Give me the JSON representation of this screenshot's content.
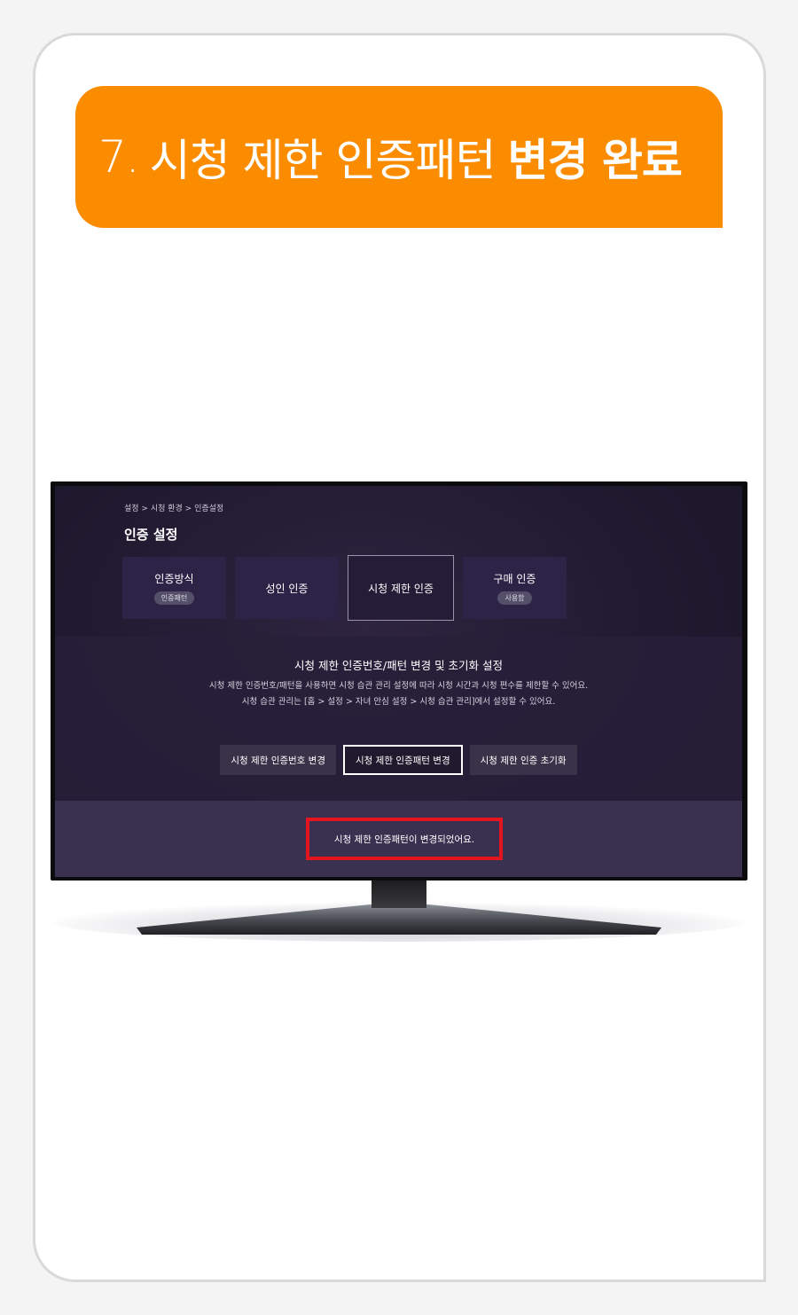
{
  "step_banner": {
    "number": "7.",
    "text_light": "시청 제한 인증패턴",
    "text_bold": "변경 완료"
  },
  "tv_screen": {
    "breadcrumb": "설정 > 시청 환경 > 인증설정",
    "page_title": "인증 설정",
    "menu": [
      {
        "label": "인증방식",
        "badge": "인증패턴",
        "selected": false
      },
      {
        "label": "성인 인증",
        "badge": "",
        "selected": false
      },
      {
        "label": "시청 제한 인증",
        "badge": "",
        "selected": true
      },
      {
        "label": "구매 인증",
        "badge": "사용함",
        "selected": false
      }
    ],
    "info": {
      "title": "시청 제한 인증번호/패턴 변경 및 초기화 설정",
      "desc_line1": "시청 제한 인증번호/패턴을 사용하면 시청 습관 관리 설정에 따라 시청 시간과 시청 편수를 제한할 수 있어요.",
      "desc_line2": "시청 습관 관리는 [홈 > 설정 > 자녀 안심 설정 > 시청 습관 관리]에서 설정할 수 있어요."
    },
    "buttons": [
      {
        "label": "시청 제한 인증번호 변경",
        "focused": false
      },
      {
        "label": "시청 제한 인증패턴 변경",
        "focused": true
      },
      {
        "label": "시청 제한 인증 초기화",
        "focused": false
      }
    ],
    "toast": "시청 제한 인증패턴이 변경되었어요."
  },
  "colors": {
    "banner_orange": "#fb8c00",
    "highlight_red": "#e3151f",
    "screen_bg": "#201a30"
  }
}
